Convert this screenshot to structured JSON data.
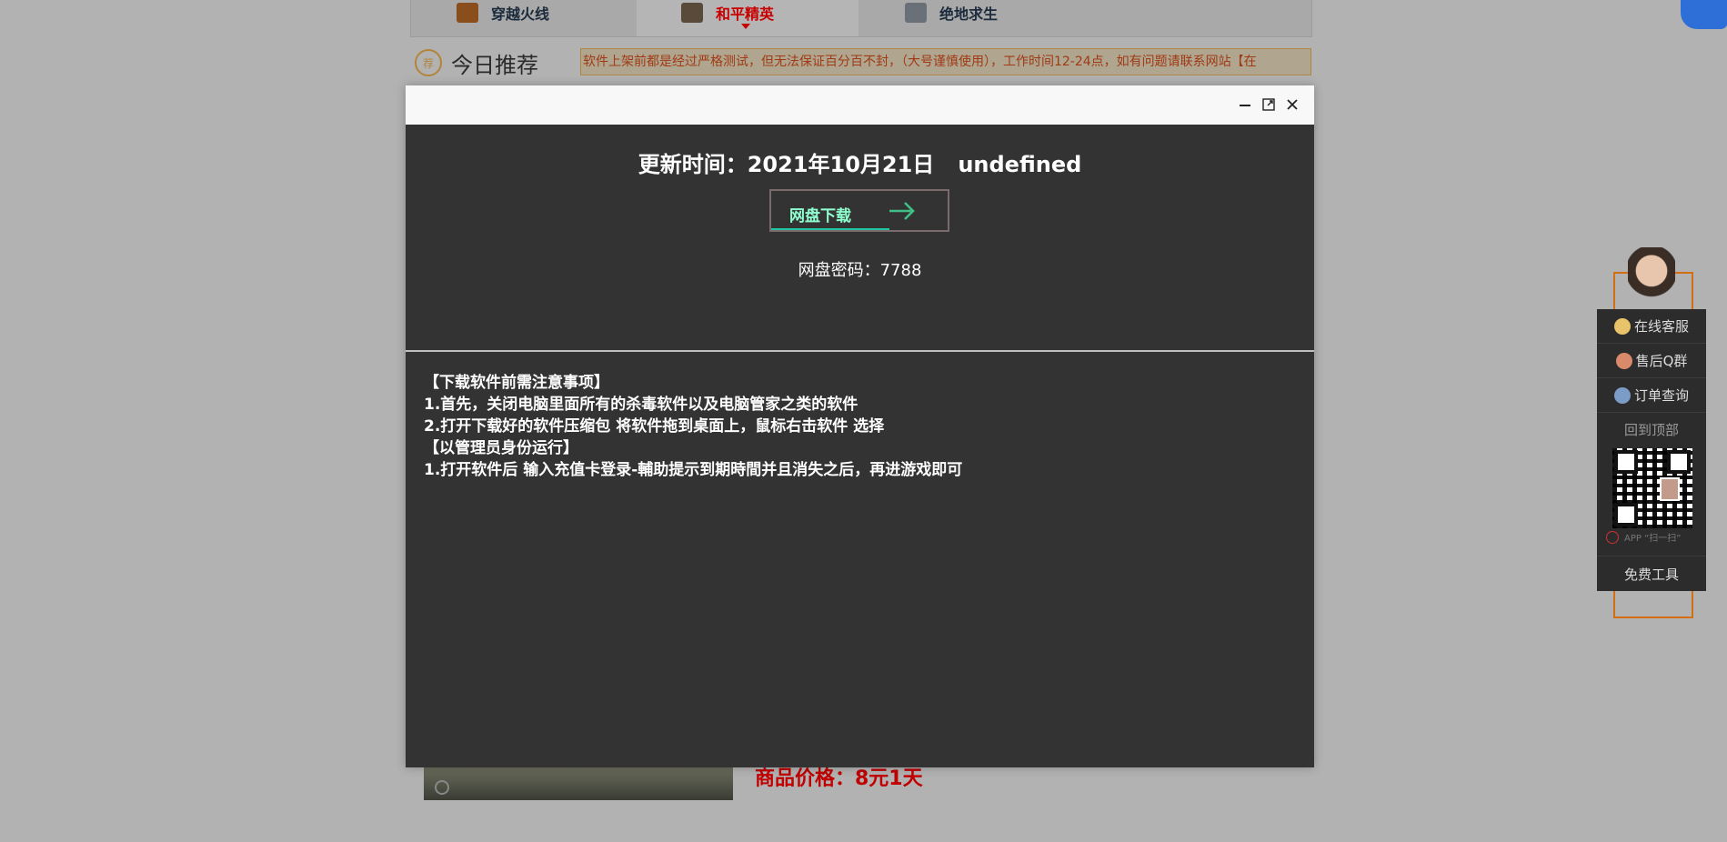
{
  "nav": {
    "tabs": [
      {
        "label": "穿越火线"
      },
      {
        "label": "和平精英"
      },
      {
        "label": "绝地求生"
      }
    ]
  },
  "recommend": {
    "badge": "荐",
    "title": "今日推荐",
    "marquee": "软件上架前都是经过严格测试，但无法保证百分百不封，（大号谨慎使用），工作时间12-24点，如有问题请联系网站【在"
  },
  "product": {
    "price_text": "商品价格：8元1天"
  },
  "modal": {
    "update_label": "更新时间：2021年10月21日",
    "update_extra": "undefined",
    "download_label": "网盘下载",
    "password_text": "网盘密码：7788",
    "notes": [
      "【下载软件前需注意事项】",
      "1.首先，关闭电脑里面所有的杀毒软件以及电脑管家之类的软件",
      "2.打开下载好的软件压缩包 将软件拖到桌面上，鼠标右击软件 选择",
      "【以管理员身份运行】",
      "1.打开软件后 输入充值卡登录-輔助提示到期時間并且消失之后，再进游戏即可"
    ]
  },
  "sidebar": {
    "items": [
      {
        "label": "在线客服",
        "icon": "qq-penguin-icon"
      },
      {
        "label": "售后Q群",
        "icon": "group-icon"
      },
      {
        "label": "订单查询",
        "icon": "order-icon"
      }
    ],
    "back_to_top": "回到顶部",
    "qr_caption": "APP “扫一扫”",
    "free_tools": "免费工具"
  },
  "colors": {
    "overlay_bg": "#b2b2b2",
    "modal_bg": "#333333",
    "accent_red": "#c10000",
    "download_text": "#8fffcf",
    "sidebar_border": "#d36e13"
  }
}
